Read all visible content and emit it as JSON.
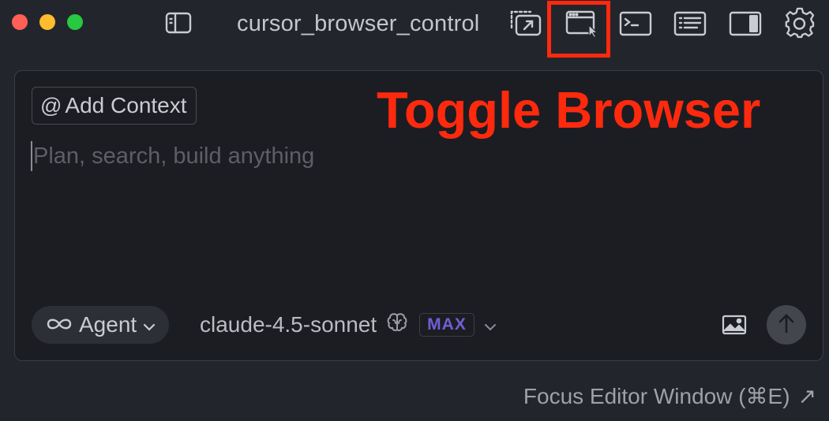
{
  "window": {
    "title": "cursor_browser_control",
    "traffic_lights": [
      "close",
      "minimize",
      "zoom"
    ]
  },
  "toolbar": {
    "icons": [
      "sidebar-toggle-icon",
      "open-external-window-icon",
      "browser-window-icon",
      "terminal-icon",
      "list-panel-icon",
      "right-panel-icon",
      "gear-icon"
    ],
    "highlighted": "browser-window-icon",
    "highlight_color": "#ff2a0e"
  },
  "annotation": {
    "text": "Toggle Browser",
    "color": "#ff2a0e"
  },
  "composer": {
    "add_context_label": "Add Context",
    "add_context_prefix": "@",
    "placeholder": "Plan, search, build anything",
    "mode_label": "Agent",
    "model_label": "claude-4.5-sonnet",
    "max_badge": "MAX",
    "max_color": "#6f5fd6"
  },
  "footer": {
    "link_label": "Focus Editor Window (⌘E)",
    "link_arrow": "↗"
  },
  "colors": {
    "background": "#23252c",
    "panel": "#1c1d22",
    "accent_red": "#ff2a0e"
  }
}
